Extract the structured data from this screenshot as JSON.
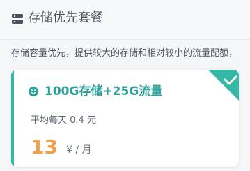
{
  "header": {
    "title": "存储优先套餐",
    "icon": "server-icon"
  },
  "description": "存储容量优先，提供较大的存储和相对较小的流量配额，",
  "plan_card": {
    "selected": true,
    "plan_icon": "plan-dot-icon",
    "title": "100G存储+25G流量",
    "daily_price_text": "平均每天 0.4 元",
    "price": "13",
    "unit": "¥ / 月",
    "accent_color": "#34b8a6",
    "price_color": "#f0a04b"
  }
}
